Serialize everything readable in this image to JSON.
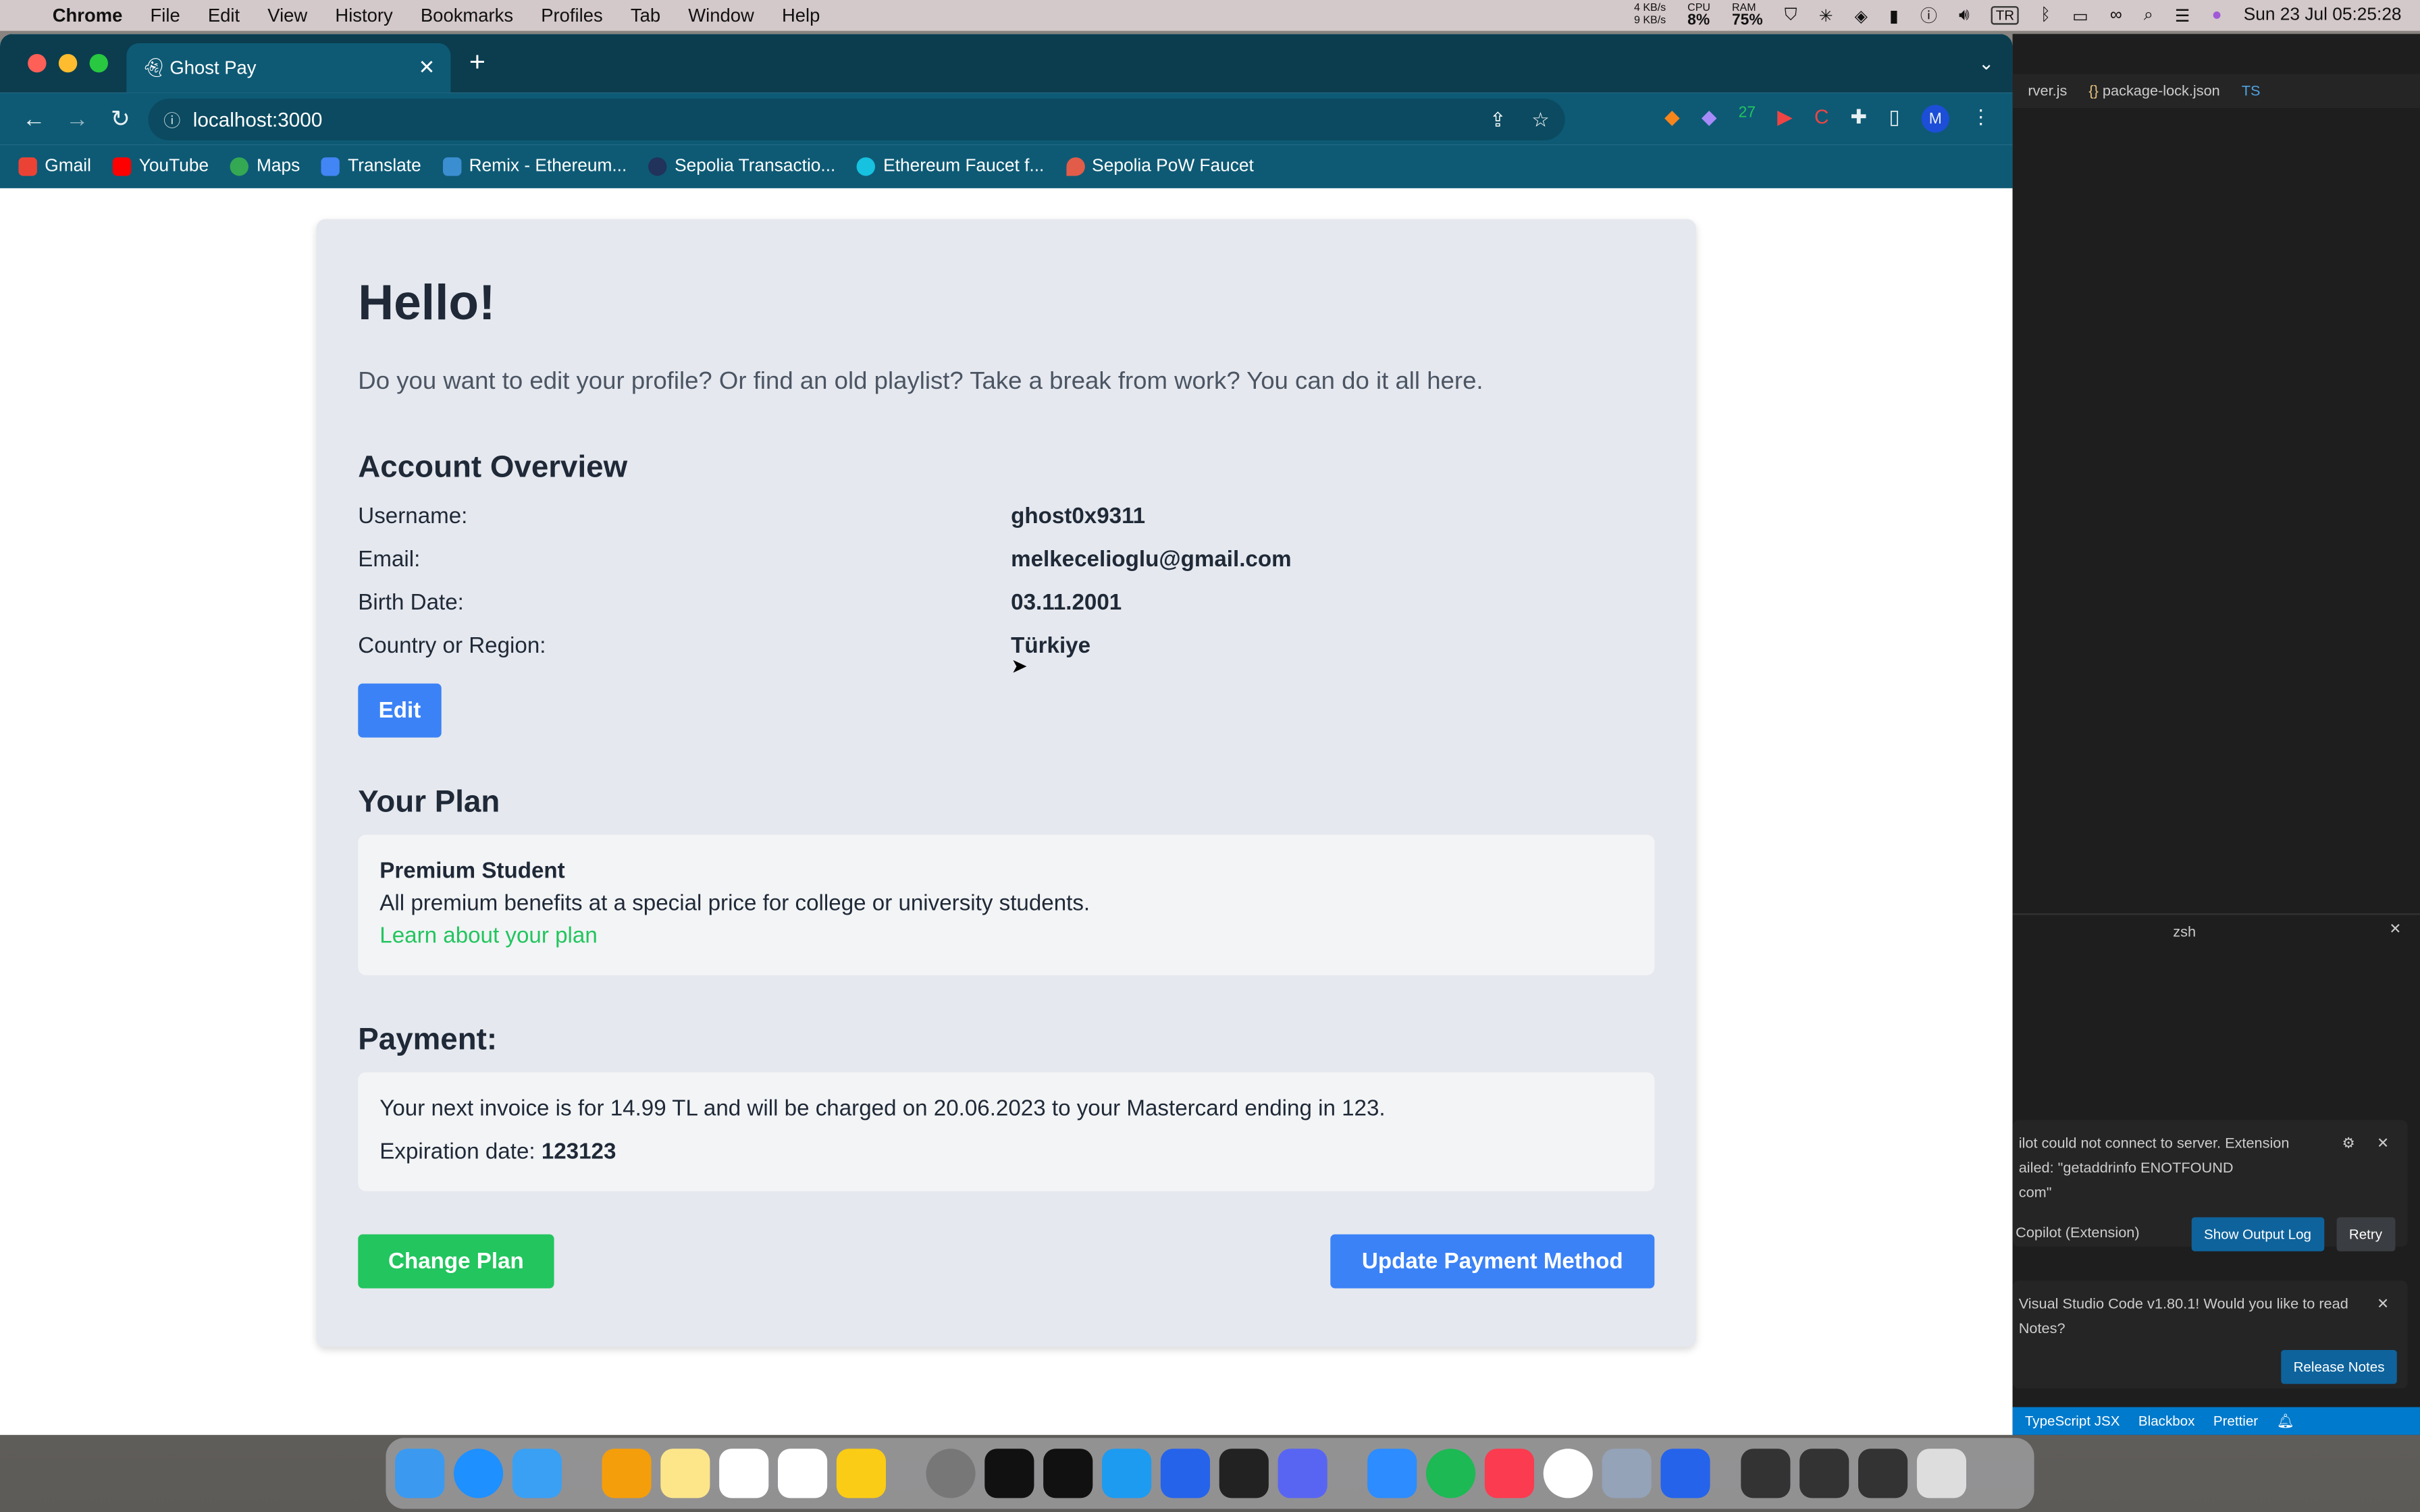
{
  "menubar": {
    "app": "Chrome",
    "items": [
      "File",
      "Edit",
      "View",
      "History",
      "Bookmarks",
      "Profiles",
      "Tab",
      "Window",
      "Help"
    ],
    "net_up": "4 KB/s",
    "net_down": "9 KB/s",
    "cpu_label": "CPU",
    "cpu": "8%",
    "ram_label": "RAM",
    "ram": "75%",
    "input_source": "TR",
    "datetime": "Sun 23 Jul  05:25:28"
  },
  "browser": {
    "tab_title": "Ghost Pay",
    "url": "localhost:3000",
    "profile": "M",
    "bookmarks": [
      {
        "label": "Gmail",
        "color": "#ea4335"
      },
      {
        "label": "YouTube",
        "color": "#ff0000"
      },
      {
        "label": "Maps",
        "color": "#34a853"
      },
      {
        "label": "Translate",
        "color": "#4285f4"
      },
      {
        "label": "Remix - Ethereum...",
        "color": "#3b8ed0"
      },
      {
        "label": "Sepolia Transactio...",
        "color": "#21325b"
      },
      {
        "label": "Ethereum Faucet f...",
        "color": "#16c2e0"
      },
      {
        "label": "Sepolia PoW Faucet",
        "color": "#e25c4a"
      }
    ]
  },
  "page": {
    "greeting": "Hello!",
    "intro": "Do you want to edit your profile? Or find an old playlist? Take a break from work? You can do it all here.",
    "account": {
      "title": "Account Overview",
      "rows": [
        {
          "label": "Username:",
          "value": "ghost0x9311"
        },
        {
          "label": "Email:",
          "value": "melkecelioglu@gmail.com"
        },
        {
          "label": "Birth Date:",
          "value": "03.11.2001"
        },
        {
          "label": "Country or Region:",
          "value": "Türkiye"
        }
      ],
      "edit": "Edit"
    },
    "plan": {
      "title": "Your Plan",
      "name": "Premium Student",
      "description": "All premium benefits at a special price for college or university students.",
      "link": "Learn about your plan"
    },
    "payment": {
      "title": "Payment:",
      "invoice": "Your next invoice is for 14.99 TL and will be charged on 20.06.2023 to your Mastercard ending in 123.",
      "exp_label": "Expiration date:",
      "exp_value": "123123"
    },
    "change_plan": "Change Plan",
    "update_payment": "Update Payment Method",
    "colors": {
      "primary": "#3b82f6",
      "success": "#22c55e"
    }
  },
  "vscode": {
    "tabs": [
      "rver.js",
      "package-lock.json",
      "TS"
    ],
    "terminal": "zsh",
    "notif1": {
      "lines": [
        "ilot could not connect to server. Extension",
        "ailed: \"getaddrinfo ENOTFOUND",
        "com\""
      ],
      "source": "Copilot (Extension)",
      "btn1": "Show Output Log",
      "btn2": "Retry"
    },
    "notif2": {
      "lines": [
        "Visual Studio Code v1.80.1! Would you like to read",
        "Notes?"
      ],
      "btn": "Release Notes"
    },
    "status": [
      "TypeScript JSX",
      "Blackbox",
      "Prettier"
    ]
  }
}
